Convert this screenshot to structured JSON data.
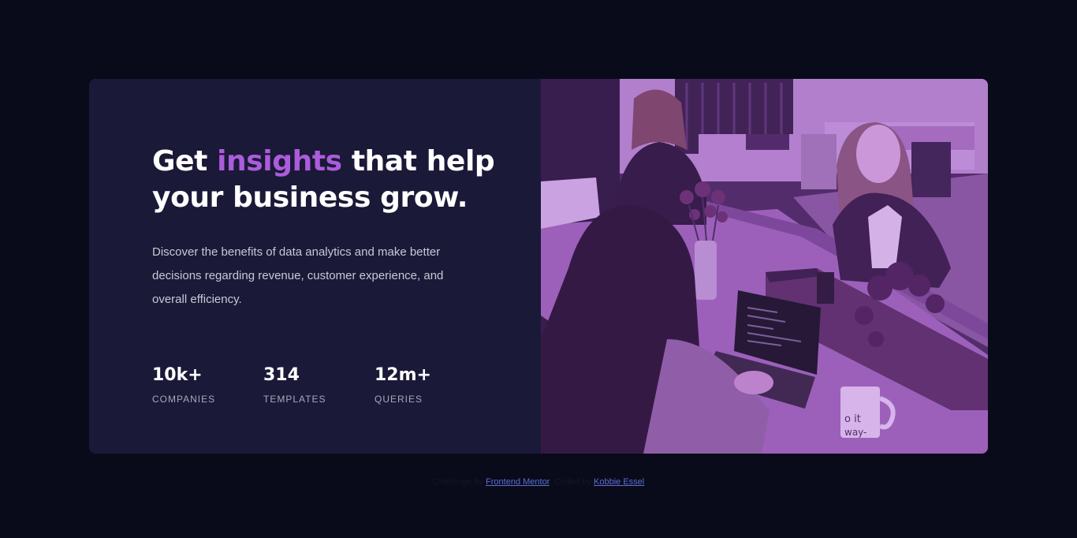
{
  "hero": {
    "headline_pre": "Get ",
    "headline_accent": "insights",
    "headline_post": " that help your business grow.",
    "description": "Discover the benefits of data analytics and make better decisions regarding revenue, customer experience, and overall efficiency."
  },
  "stats": [
    {
      "value": "10k+",
      "label": "COMPANIES"
    },
    {
      "value": "314",
      "label": "TEMPLATES"
    },
    {
      "value": "12m+",
      "label": "QUERIES"
    }
  ],
  "image": {
    "mug_text_1": "o it",
    "mug_text_2": "way-"
  },
  "footer": {
    "challenge_prefix": "Challenge by ",
    "challenge_link": "Frontend Mentor",
    "coded_prefix": ". Coded by ",
    "coded_link": "Kobbie Essel"
  },
  "colors": {
    "background": "#090b1a",
    "card": "#1b1938",
    "accent": "#ab5cdb",
    "image_tint": "#aa5cdb"
  }
}
